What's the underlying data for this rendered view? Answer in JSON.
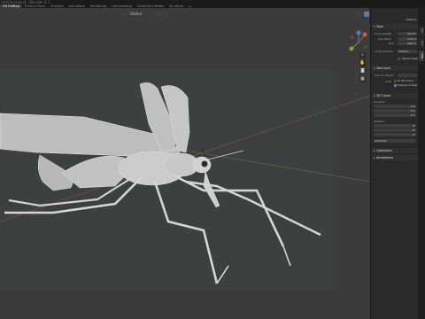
{
  "app": {
    "title": "Untitled.blend - Blender 4.1"
  },
  "workspaces": {
    "tabs": [
      "UV Editing",
      "Texture Paint",
      "Shading",
      "Animation",
      "Rendering",
      "Compositing",
      "Geometry Nodes",
      "Scripting"
    ],
    "active_index": 0,
    "add_label": "+"
  },
  "viewport": {
    "view_mode": "Global",
    "options_label": "Options"
  },
  "sidebar": {
    "view_panel": {
      "title": "View",
      "focal_label": "Focal Length",
      "focal_value": "50 mm",
      "clip_label": "Clip Start",
      "clip_start": "0.01 m",
      "clip_end_label": "End",
      "clip_end": "1000 m",
      "local_camera_label": "Local Camera",
      "local_camera_value": "Camera",
      "render_region_label": "Render Region"
    },
    "view_lock_panel": {
      "title": "View Lock",
      "lock_to_object_label": "Lock to Object",
      "lock_label": "Lock",
      "to_cursor_label": "To 3D Cursor",
      "camera_to_view_label": "Camera to View"
    },
    "cursor_panel": {
      "title": "3D Cursor",
      "location_label": "Location",
      "loc_x": "0 m",
      "loc_y": "0 m",
      "loc_z": "0 m",
      "rotation_label": "Rotation",
      "rot_x": "0°",
      "rot_y": "0°",
      "rot_z": "0°",
      "rot_mode": "XYZ Euler"
    },
    "collapsed": [
      "Collections",
      "Annotations"
    ]
  },
  "side_tabs": [
    "Item",
    "Tool",
    "View"
  ],
  "colors": {
    "accent": "#4f80c5",
    "axis_x": "#c0554f",
    "axis_y": "#6f9a3a",
    "wire": "#d9d9d9"
  }
}
